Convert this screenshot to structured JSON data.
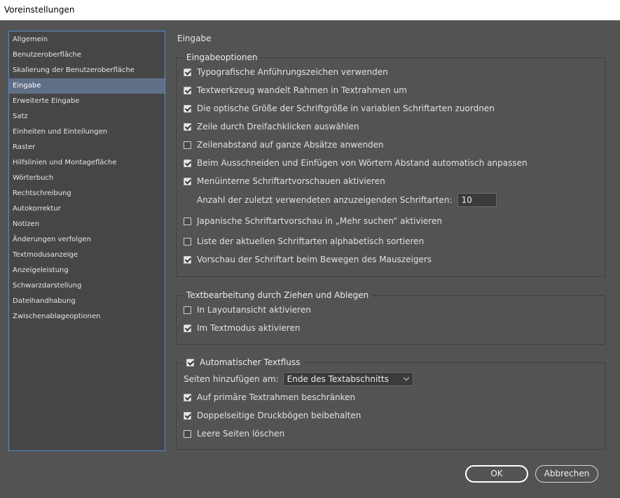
{
  "window": {
    "title": "Voreinstellungen"
  },
  "sidebar": {
    "items": [
      {
        "label": "Allgemein"
      },
      {
        "label": "Benutzeroberfläche"
      },
      {
        "label": "Skalierung der Benutzeroberfläche"
      },
      {
        "label": "Eingabe",
        "selected": true
      },
      {
        "label": "Erweiterte Eingabe"
      },
      {
        "label": "Satz"
      },
      {
        "label": "Einheiten und Einteilungen"
      },
      {
        "label": "Raster"
      },
      {
        "label": "Hilfslinien und Montagefläche"
      },
      {
        "label": "Wörterbuch"
      },
      {
        "label": "Rechtschreibung"
      },
      {
        "label": "Autokorrektur"
      },
      {
        "label": "Notizen"
      },
      {
        "label": "Änderungen verfolgen"
      },
      {
        "label": "Textmodusanzeige"
      },
      {
        "label": "Anzeigeleistung"
      },
      {
        "label": "Schwarzdarstellung"
      },
      {
        "label": "Dateihandhabung"
      },
      {
        "label": "Zwischenablageoptionen"
      }
    ]
  },
  "main": {
    "title": "Eingabe",
    "input_options": {
      "title": "Eingabeoptionen",
      "typographic_quotes": {
        "label": "Typografische Anführungszeichen verwenden",
        "checked": true
      },
      "type_tool_converts": {
        "label": "Textwerkzeug wandelt Rahmen in Textrahmen um",
        "checked": true
      },
      "optical_size": {
        "label": "Die optische Größe der Schriftgröße in variablen Schriftarten zuordnen",
        "checked": true
      },
      "triple_click": {
        "label": "Zeile durch Dreifachklicken auswählen",
        "checked": true
      },
      "leading_whole": {
        "label": "Zeilenabstand auf ganze Absätze anwenden",
        "checked": false
      },
      "adjust_spacing": {
        "label": "Beim Ausschneiden und Einfügen von Wörtern Abstand automatisch anpassen",
        "checked": true
      },
      "menu_preview": {
        "label": "Menüinterne Schriftartvorschauen aktivieren",
        "checked": true
      },
      "recent_fonts": {
        "label": "Anzahl der zuletzt verwendeten anzuzeigenden Schriftarten:",
        "value": "10"
      },
      "japanese_preview": {
        "label": "Japanische Schriftartvorschau in „Mehr suchen“ aktivieren",
        "checked": false
      },
      "sort_fonts": {
        "label": "Liste der aktuellen Schriftarten alphabetisch sortieren",
        "checked": false
      },
      "hover_preview": {
        "label": "Vorschau der Schriftart beim Bewegen des Mauszeigers",
        "checked": true
      }
    },
    "drag_drop": {
      "title": "Textbearbeitung durch Ziehen und Ablegen",
      "layout_view": {
        "label": "In Layoutansicht aktivieren",
        "checked": false
      },
      "story_editor": {
        "label": "Im Textmodus aktivieren",
        "checked": true
      }
    },
    "smart_reflow": {
      "label": "Automatischer Textfluss",
      "checked": true,
      "add_pages": {
        "label": "Seiten hinzufügen am:",
        "value": "Ende des Textabschnitts"
      },
      "limit_primary": {
        "label": "Auf primäre Textrahmen beschränken",
        "checked": true
      },
      "preserve_spreads": {
        "label": "Doppelseitige Druckbögen beibehalten",
        "checked": true
      },
      "delete_empty": {
        "label": "Leere Seiten löschen",
        "checked": false
      }
    }
  },
  "footer": {
    "ok_label": "OK",
    "cancel_label": "Abbrechen"
  }
}
